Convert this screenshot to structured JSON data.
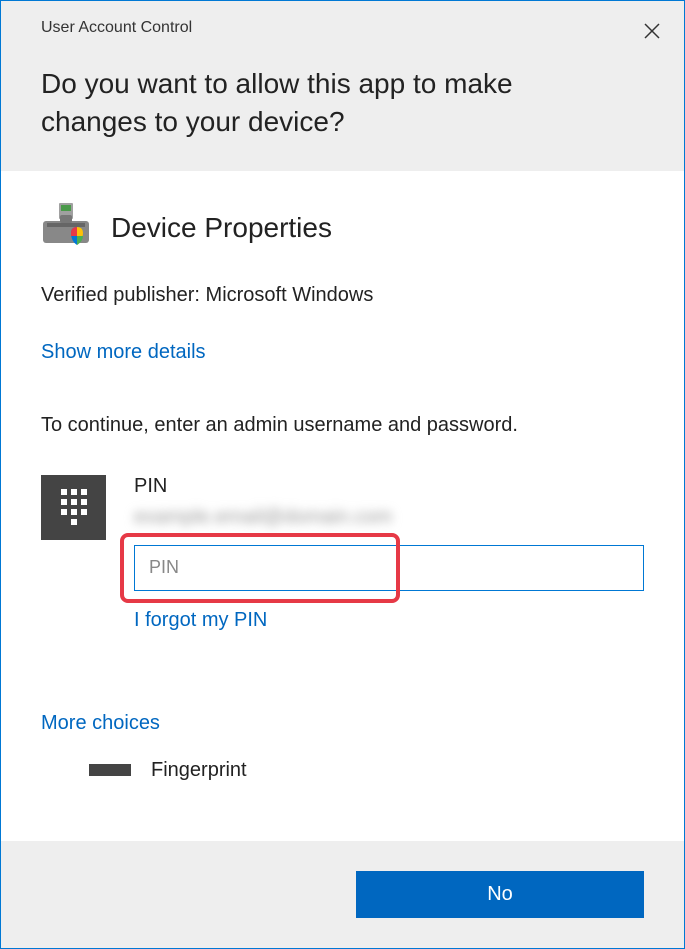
{
  "header": {
    "title_bar": "User Account Control",
    "main_question": "Do you want to allow this app to make changes to your device?"
  },
  "app": {
    "name": "Device Properties",
    "publisher_line": "Verified publisher: Microsoft Windows"
  },
  "links": {
    "show_more": "Show more details",
    "forgot_pin": "I forgot my PIN",
    "more_choices": "More choices"
  },
  "auth": {
    "continue_text": "To continue, enter an admin username and password.",
    "pin_label": "PIN",
    "blurred_email": "example.email@domain.com",
    "pin_placeholder": "PIN",
    "fingerprint_label": "Fingerprint"
  },
  "footer": {
    "no_label": "No"
  }
}
